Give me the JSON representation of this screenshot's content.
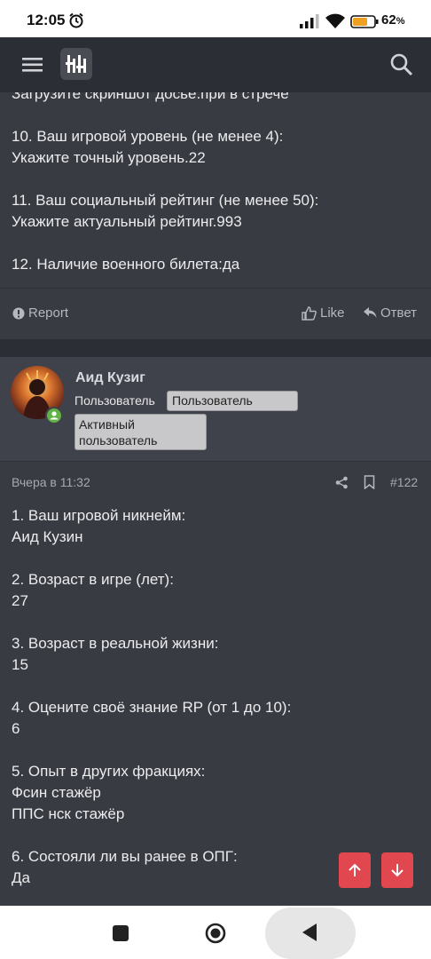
{
  "status_bar": {
    "time": "12:05",
    "battery": "62",
    "battery_unit": "%"
  },
  "top_post": {
    "text": "Загрузите скриншот досье.при в стрече\n\n10. Ваш игровой уровень (не менее 4):\nУкажите точный уровень.22\n\n11. Ваш социальный рейтинг (не менее 50):\nУкажите актуальный рейтинг.993\n\n12. Наличие военного билета:да",
    "report_label": "Report",
    "like_label": "Like",
    "reply_label": "Ответ"
  },
  "user": {
    "name": "Аид Кузиг",
    "role": "Пользователь",
    "badge1": "Пользователь",
    "badge2": "Активный пользователь"
  },
  "post": {
    "time": "Вчера в 11:32",
    "number": "#122",
    "text": "1. Ваш игровой никнейм:\nАид Кузин\n\n2. Возраст в игре (лет):\n27\n\n3. Возраст в реальной жизни:\n15\n\n4. Оцените своё знание RP (от 1 до 10):\n6\n\n5. Опыт в других фракциях:\nФсин стажёр\nППС нск стажёр\n\n6. Состояли ли вы ранее в ОПГ:\nДа"
  },
  "colors": {
    "accent": "#e0474f",
    "background": "#383b42",
    "header": "#2b2e34",
    "online": "#63b245"
  },
  "icons": [
    "alarm-icon",
    "signal-icon",
    "wifi-icon",
    "battery-icon",
    "menu-icon",
    "logo-icon",
    "search-icon",
    "report-icon",
    "like-icon",
    "reply-icon",
    "share-icon",
    "bookmark-icon",
    "arrow-up-icon",
    "arrow-down-icon"
  ]
}
